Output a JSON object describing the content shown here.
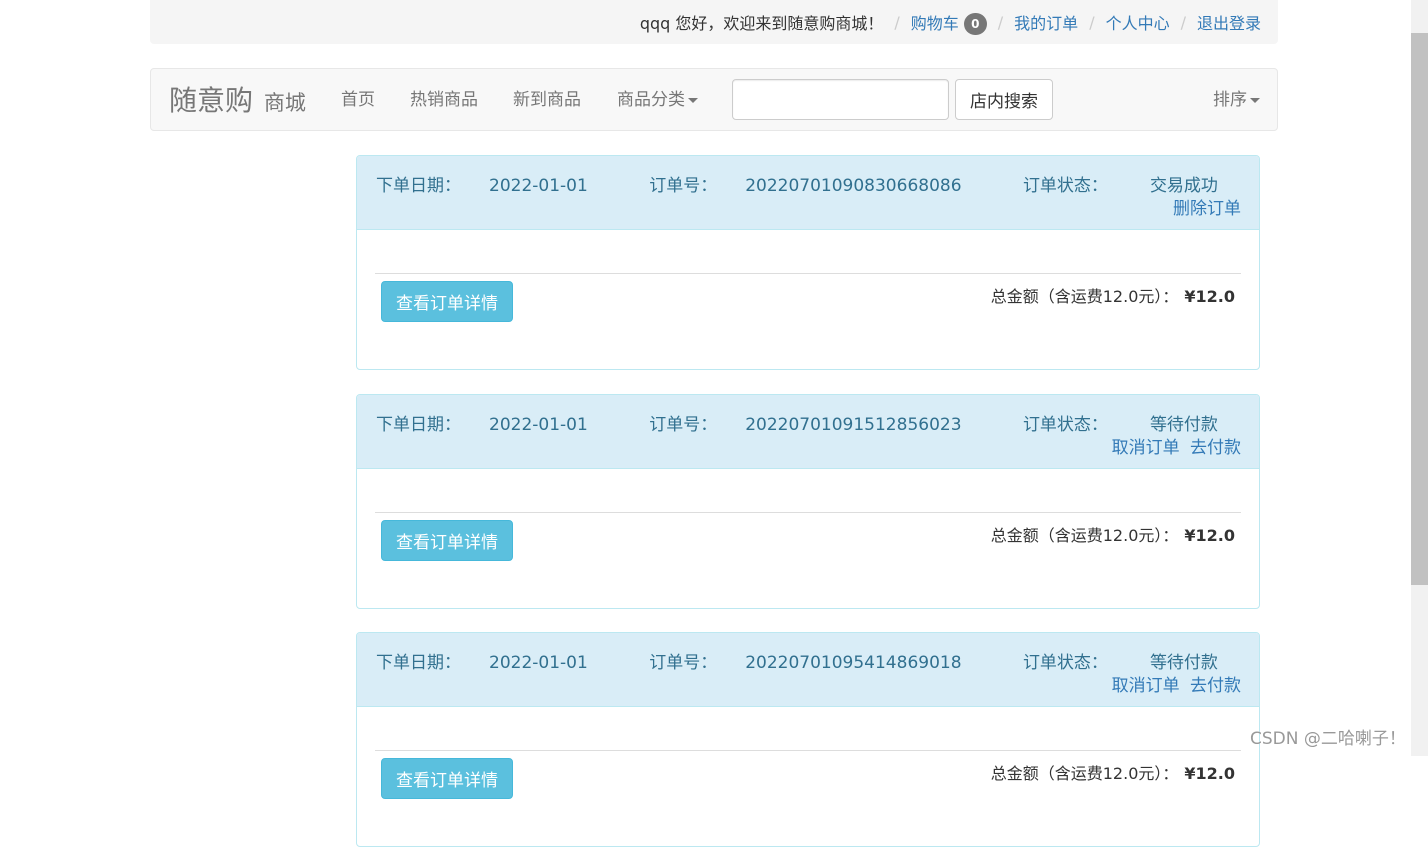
{
  "topbar": {
    "greeting": "qqq 您好，欢迎来到随意购商城！",
    "cart_label": "购物车",
    "cart_count": "0",
    "my_orders": "我的订单",
    "profile": "个人中心",
    "logout": "退出登录"
  },
  "navbar": {
    "brand": "随意购",
    "brand_sub": "商城",
    "items": [
      "首页",
      "热销商品",
      "新到商品",
      "商品分类"
    ],
    "search_value": "",
    "search_button": "店内搜索",
    "sort_label": "排序"
  },
  "labels": {
    "date": "下单日期：",
    "order_no": "订单号：",
    "status": "订单状态："
  },
  "orders": [
    {
      "date": "2022-01-01",
      "order_no": "20220701090830668086",
      "status": "交易成功",
      "actions": [
        "删除订单"
      ],
      "detail_button": "查看订单详情",
      "total_label": "总金额（含运费12.0元）：",
      "total": "¥12.0"
    },
    {
      "date": "2022-01-01",
      "order_no": "20220701091512856023",
      "status": "等待付款",
      "actions": [
        "取消订单",
        "去付款"
      ],
      "detail_button": "查看订单详情",
      "total_label": "总金额（含运费12.0元）：",
      "total": "¥12.0"
    },
    {
      "date": "2022-01-01",
      "order_no": "20220701095414869018",
      "status": "等待付款",
      "actions": [
        "取消订单",
        "去付款"
      ],
      "detail_button": "查看订单详情",
      "total_label": "总金额（含运费12.0元）：",
      "total": "¥12.0"
    }
  ],
  "watermark": "CSDN @二哈喇子！"
}
